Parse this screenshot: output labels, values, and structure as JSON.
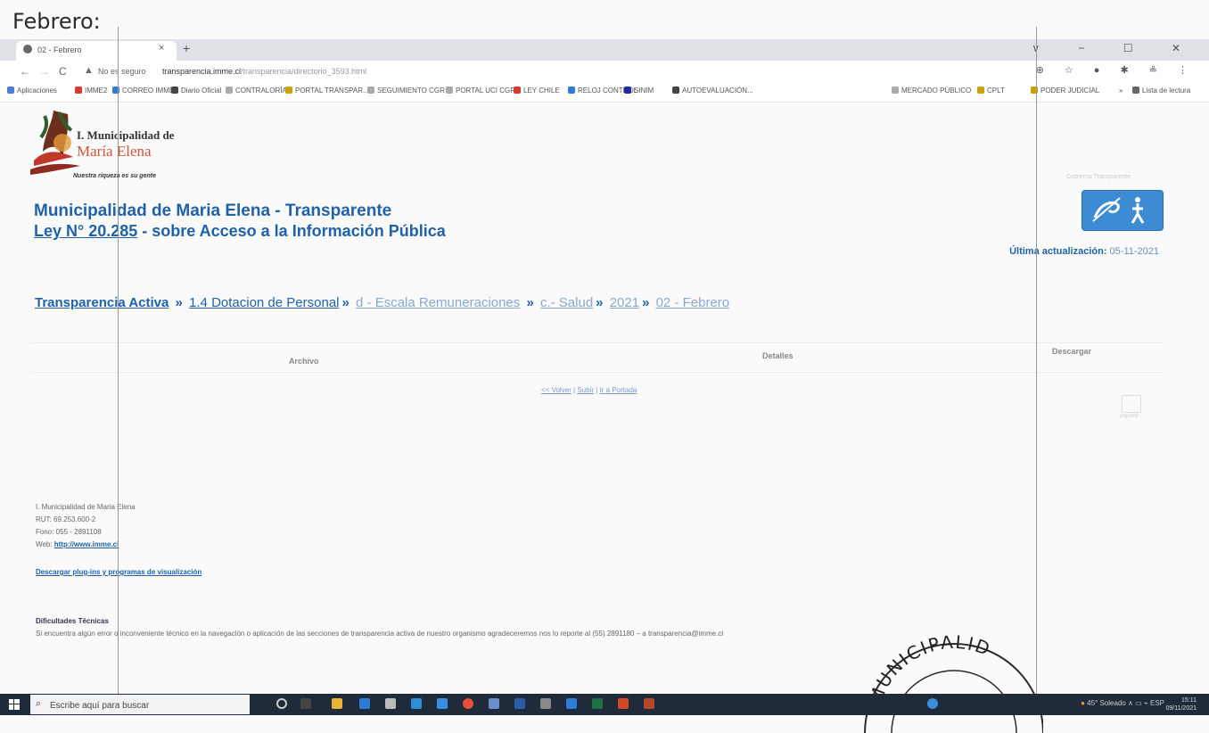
{
  "doc_heading": "Febrero:",
  "browser": {
    "tab_title": "02 - Febrero",
    "tab_close": "×",
    "new_tab": "+",
    "window_controls": "∨ − ☐ ✕",
    "nav_back": "←",
    "nav_forward": "→",
    "nav_reload": "C",
    "warning_icon": "▲",
    "not_secure": "No es seguro",
    "url_host": "transparencia.imme.cl",
    "url_path": "/transparencia/directorio_3593.html",
    "bookmarks": [
      "Aplicaciones",
      "IMME2",
      "CORREO IMME",
      "Diario Oficial",
      "CONTRALORÍA",
      "PORTAL TRANSPAR...",
      "SEGUIMIENTO CGR",
      "PORTAL UCI CGR",
      "LEY CHILE",
      "RELOJ CONTROL",
      "SINIM",
      "AUTOEVALUACIÓN...",
      "MERCADO PÚBLICO",
      "CPLT",
      "PODER JUDICIAL",
      "»",
      "Lista de lectura"
    ],
    "bookmark_colors": [
      "#4f7bd8",
      "#d63b2f",
      "#2e7cd6",
      "#444",
      "#aaa",
      "#c9a100",
      "#aaa",
      "#aaa",
      "#d63b2f",
      "#2e7cd6",
      "#2a2aa0",
      "#444",
      "#aaa",
      "#c9a100",
      "#c9a100",
      "#fff",
      "#666"
    ]
  },
  "page": {
    "logo_line1": "I. Municipalidad de",
    "logo_line2": "María Elena",
    "logo_slogan": "Nuestra riqueza es su gente",
    "gob_label": "Gobierno Transparente",
    "title1": "Municipalidad de Maria Elena - Transparente",
    "title2_law": "Ley N° 20.285",
    "title2_rest": " - sobre Acceso a la Información Pública",
    "last_update_label": "Última actualización:",
    "last_update_value": "05-11-2021",
    "breadcrumb": [
      "Transparencia Activa",
      "1.4 Dotacion de Personal",
      "d - Escala Remuneraciones",
      "c.- Salud",
      "2021",
      "02 - Febrero"
    ],
    "breadcrumb_sep": "»",
    "table_headers": {
      "archivo": "Archivo",
      "detalles": "Detalles",
      "descargar": "Descargar"
    },
    "nav_links": {
      "back": "<< Volver",
      "up": "Subir",
      "home": "Ir a Portada",
      "sep": " | "
    },
    "print_label": "imprimir",
    "footer": {
      "org": "I. Municipalidad de Maria Elena",
      "rut": "RUT: 69.253.600-2",
      "phone": "Fono: 055 - 2891108",
      "web_label": "Web: ",
      "web_link": "http://www.imme.cl",
      "plugins": "Descargar plug-ins y programas de visualización",
      "tech_title": "Dificultades Técnicas",
      "tech_text": "Si encuentra algún error o inconveniente técnico en la navegación o aplicación de las secciones de transparencia activa de nuestro organismo agradeceremos nos lo reporte al (55) 2891180 – a transparencia@imme.cl"
    }
  },
  "stamp_text": "MUNICIPALID",
  "taskbar": {
    "search_placeholder": "Escribe aquí para buscar",
    "weather": "45° Soleado",
    "lang": "ESP",
    "time": "15:11",
    "date": "09/11/2021"
  }
}
